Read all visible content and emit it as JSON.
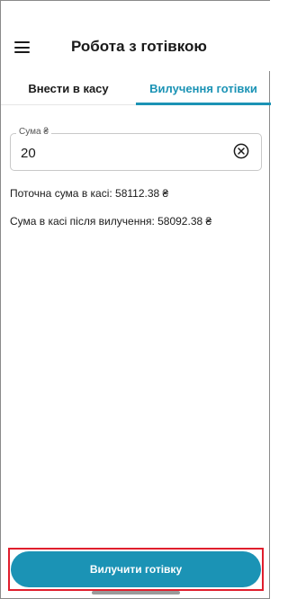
{
  "header": {
    "title": "Робота з готівкою",
    "menu_icon": "hamburger-menu-icon"
  },
  "tabs": [
    {
      "label": "Внести в касу",
      "active": false
    },
    {
      "label": "Вилучення готівки",
      "active": true
    }
  ],
  "form": {
    "amount_label": "Сума ₴",
    "amount_value": "20",
    "clear_icon": "clear-circle-icon"
  },
  "info": {
    "current_sum": "Поточна сума в касі: 58112.38 ₴",
    "after_sum": "Сума в касі після вилучення: 58092.38 ₴"
  },
  "action": {
    "submit_label": "Вилучити готівку"
  },
  "colors": {
    "accent": "#1b93b5",
    "highlight_border": "#e01e2d",
    "text": "#1a1a1a"
  }
}
